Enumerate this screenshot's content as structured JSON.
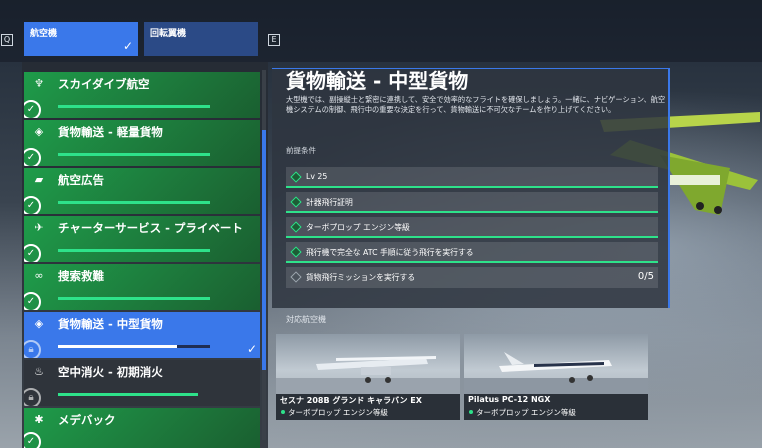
{
  "hotkeys": {
    "prev": "Q",
    "next": "E"
  },
  "tabs": [
    {
      "label": "航空機",
      "active": true
    },
    {
      "label": "回転翼機",
      "active": false
    }
  ],
  "missions": [
    {
      "label": "スカイダイブ航空",
      "icon": "parachute-icon",
      "status": "completed"
    },
    {
      "label": "貨物輸送 - 軽量貨物",
      "icon": "cargo-box-icon",
      "status": "completed"
    },
    {
      "label": "航空広告",
      "icon": "banner-icon",
      "status": "completed"
    },
    {
      "label": "チャーターサービス - プライベート",
      "icon": "charter-icon",
      "status": "completed"
    },
    {
      "label": "捜索救難",
      "icon": "binoculars-icon",
      "status": "completed"
    },
    {
      "label": "貨物輸送 - 中型貨物",
      "icon": "cargo-box-icon",
      "status": "selected",
      "progress": 0.78
    },
    {
      "label": "空中消火 - 初期消火",
      "icon": "fire-icon",
      "status": "locked"
    },
    {
      "label": "メデバック",
      "icon": "medical-star-icon",
      "status": "completed"
    }
  ],
  "detail": {
    "title": "貨物輸送 - 中型貨物",
    "description": "大型機では、副操縦士と緊密に連携して、安全で効率的なフライトを確保しましょう。一緒に、ナビゲーション、航空機システムの制御、飛行中の重要な決定を行って、貨物輸送に不可欠なチームを作り上げてください。",
    "requirements_header": "前提条件",
    "requirements": [
      {
        "text": "Lv 25",
        "done": true
      },
      {
        "text": "計器飛行証明",
        "done": true
      },
      {
        "text": "ターボプロップ エンジン等級",
        "done": true
      },
      {
        "text": "飛行機で完全な ATC 手順に従う飛行を実行する",
        "done": true
      },
      {
        "text": "貨物飛行ミッションを実行する",
        "done": false,
        "count": "0/5"
      }
    ]
  },
  "aircraft_header": "対応航空機",
  "aircraft": [
    {
      "name": "セスナ 208B グランド キャラバン EX",
      "tag": "ターボプロップ エンジン等級"
    },
    {
      "name": "Pilatus PC-12 NGX",
      "tag": "ターボプロップ エンジン等級"
    }
  ],
  "colors": {
    "accent": "#3a78ea",
    "complete": "#2ee28a",
    "mission_green": "#1e9c4a"
  }
}
